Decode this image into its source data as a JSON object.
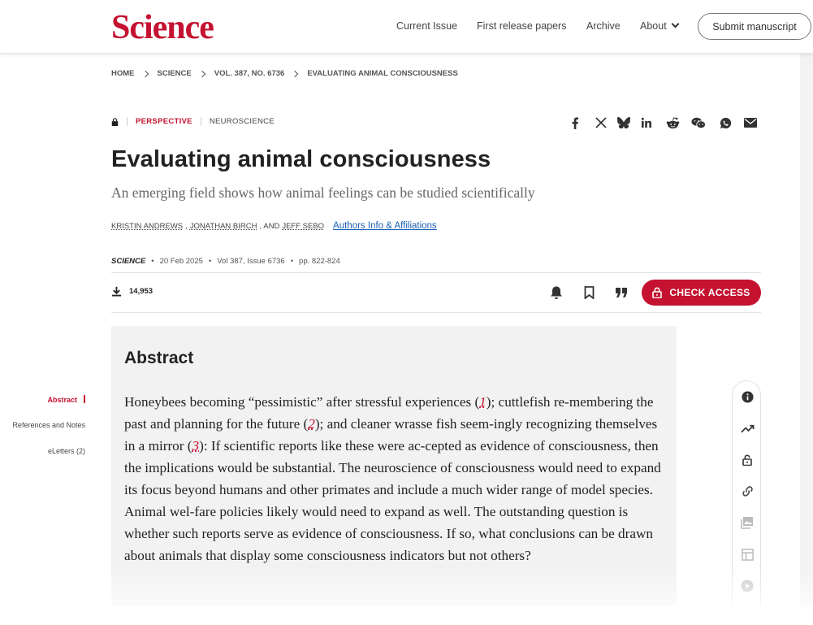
{
  "header": {
    "logo": "Science",
    "nav": [
      "Current Issue",
      "First release papers",
      "Archive",
      "About"
    ],
    "submit_label": "Submit manuscript"
  },
  "breadcrumb": [
    "HOME",
    "SCIENCE",
    "VOL. 387, NO. 6736",
    "EVALUATING ANIMAL CONSCIOUSNESS"
  ],
  "article": {
    "type": "PERSPECTIVE",
    "field": "NEUROSCIENCE",
    "title": "Evaluating animal consciousness",
    "subtitle": "An emerging field shows how animal feelings can be studied scientifically",
    "authors": [
      "KRISTIN ANDREWS",
      "JONATHAN BIRCH",
      "JEFF SEBO"
    ],
    "author_sep": ",",
    "author_and": ", AND",
    "affiliations_link": "Authors Info & Affiliations",
    "journal": "SCIENCE",
    "date": "20 Feb 2025",
    "volume": "Vol 387, Issue 6736",
    "pages": "pp. 822-824",
    "bullet": "•",
    "downloads": "14,953",
    "check_access": "CHECK ACCESS"
  },
  "share_icons": [
    "facebook-icon",
    "x-icon",
    "bluesky-icon",
    "linkedin-icon",
    "reddit-icon",
    "wechat-icon",
    "whatsapp-icon",
    "email-icon"
  ],
  "abstract": {
    "heading": "Abstract",
    "t1": "Honeybees becoming “pessimistic” after stressful experiences (",
    "r1": "1",
    "t2": "); cuttlefish re-membering the past and planning for the future (",
    "r2": "2",
    "t3": "); and cleaner wrasse fish seem-ingly recognizing themselves in a mirror (",
    "r3": "3",
    "t4": "): If scientific reports like these were ac-cepted as evidence of consciousness, then the implications would be substantial. The neuroscience of consciousness would need to expand its focus beyond humans and other primates and include a much wider range of model species. Animal wel-fare policies likely would need to expand as well. The outstanding question is whether such reports serve as evidence of consciousness. If so, what conclusions can be drawn about animals that display some consciousness indicators but not others?"
  },
  "section_nav": [
    "Abstract",
    "References and Notes",
    "eLetters (2)"
  ],
  "colors": {
    "brand": "#c41230",
    "link": "#1a5fb4"
  }
}
